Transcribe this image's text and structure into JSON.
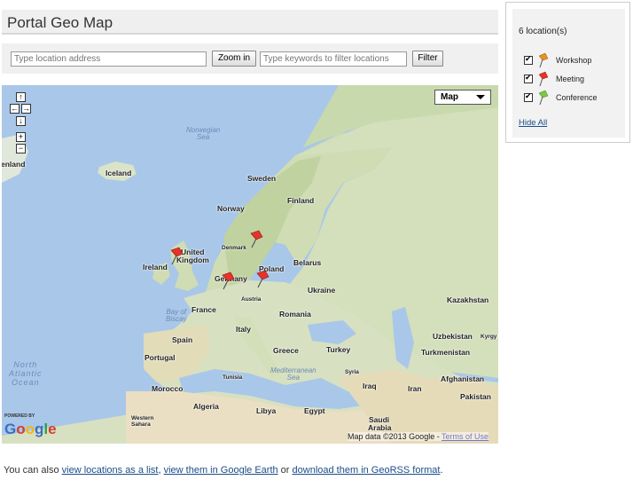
{
  "portlet": {
    "title": "Portal Geo Map"
  },
  "toolbar": {
    "address_placeholder": "Type location address",
    "zoom_label": "Zoom in",
    "filter_placeholder": "Type keywords to filter locations",
    "filter_label": "Filter"
  },
  "map": {
    "type_label": "Map",
    "labels": {
      "greenland": "enland",
      "iceland": "Iceland",
      "sweden": "Sweden",
      "finland": "Finland",
      "norway": "Norway",
      "denmark": "Denmark",
      "united_kingdom_1": "United",
      "united_kingdom_2": "Kingdom",
      "ireland": "Ireland",
      "belarus": "Belarus",
      "poland": "Poland",
      "germany": "Germany",
      "ukraine": "Ukraine",
      "austria": "Austria",
      "france": "France",
      "romania": "Romania",
      "kazakhstan": "Kazakhstan",
      "italy": "Italy",
      "spain": "Spain",
      "uzbekistan": "Uzbekistan",
      "kyrgyz": "Kyrgy",
      "greece": "Greece",
      "turkey": "Turkey",
      "turkmenistan": "Turkmenistan",
      "portugal": "Portugal",
      "syria": "Syria",
      "afghanistan": "Afghanistan",
      "iraq": "Iraq",
      "iran": "Iran",
      "morocco": "Morocco",
      "tunisia": "Tunisia",
      "pakistan": "Pakistan",
      "algeria": "Algeria",
      "libya": "Libya",
      "egypt": "Egypt",
      "saudi_1": "Saudi",
      "saudi_2": "Arabia",
      "western_sahara_1": "Western",
      "western_sahara_2": "Sahara"
    },
    "seas": {
      "norwegian_1": "Norwegian",
      "norwegian_2": "Sea",
      "biscay_1": "Bay of",
      "biscay_2": "Biscay",
      "atlantic_1": "North",
      "atlantic_2": "Atlantic",
      "atlantic_3": "Ocean",
      "med_1": "Mediterranean",
      "med_2": "Sea"
    },
    "logo": {
      "powered": "POWERED BY",
      "name": "Google"
    },
    "attribution": "Map data ©2013 Google - ",
    "terms_label": "Terms of Use",
    "pins": [
      {
        "category": "Meeting"
      },
      {
        "category": "Meeting"
      },
      {
        "category": "Meeting"
      },
      {
        "category": "Meeting"
      }
    ]
  },
  "legend": {
    "count_text": "6 location(s)",
    "items": [
      {
        "label": "Workshop",
        "color": "#e8921e",
        "checked": true
      },
      {
        "label": "Meeting",
        "color": "#e8322a",
        "checked": true
      },
      {
        "label": "Conference",
        "color": "#7ac943",
        "checked": true
      }
    ],
    "hide_all": "Hide All"
  },
  "footer": {
    "prefix": "You can also ",
    "link_list": "view locations as a list",
    "sep1": ", ",
    "link_earth": "view them in Google Earth",
    "sep2": " or ",
    "link_georss": "download them in GeoRSS format",
    "suffix": "."
  }
}
